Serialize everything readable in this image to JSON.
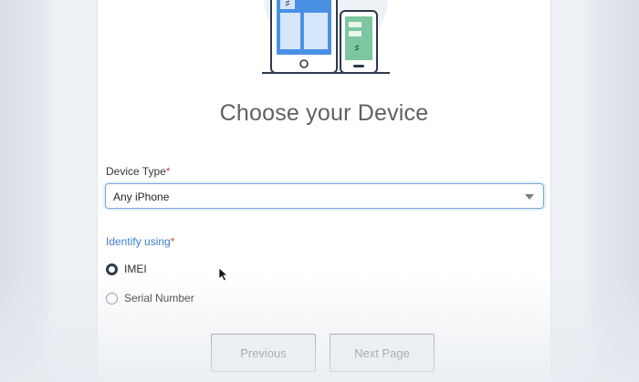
{
  "title": "Choose your Device",
  "device_type": {
    "label": "Device Type",
    "required_marker": "*",
    "selected_value": "Any iPhone"
  },
  "identify": {
    "label": "Identify using",
    "required_marker": "*",
    "options": [
      {
        "label": "IMEI",
        "checked": true
      },
      {
        "label": "Serial Number",
        "checked": false
      }
    ]
  },
  "buttons": {
    "previous": "Previous",
    "next": "Next Page"
  },
  "colors": {
    "accent": "#3d7ec9",
    "required": "#e0434b",
    "tablet_blue": "#4a90e2",
    "phone_green": "#7dc7a0"
  }
}
